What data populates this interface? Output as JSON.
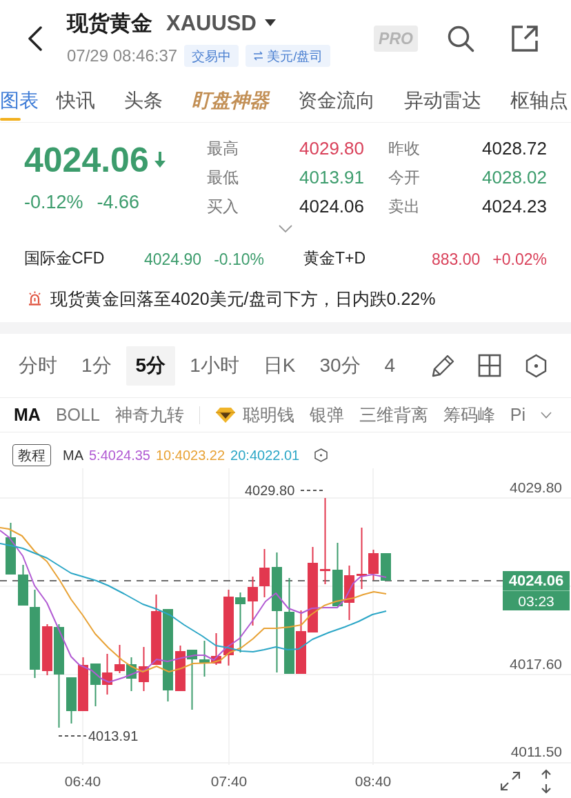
{
  "header": {
    "title": "现货黄金",
    "symbol": "XAUUSD",
    "time": "07/29 08:46:37",
    "badges": [
      {
        "kind": "status",
        "text": "交易中"
      },
      {
        "kind": "toggle",
        "text": "美元/盘司"
      }
    ],
    "pro": "PRO"
  },
  "tabs": [
    {
      "label": "图表",
      "selected": true,
      "kind": "plain"
    },
    {
      "label": "快讯",
      "selected": false,
      "kind": "plain"
    },
    {
      "label": "头条",
      "selected": false,
      "kind": "plain"
    },
    {
      "label": "盯盘神器",
      "selected": false,
      "kind": "featured"
    },
    {
      "label": "资金流向",
      "selected": false,
      "kind": "plain"
    },
    {
      "label": "异动雷达",
      "selected": false,
      "kind": "plain"
    },
    {
      "label": "枢轴点",
      "selected": false,
      "kind": "plain"
    }
  ],
  "quote": {
    "price": "4024.06",
    "falling": true,
    "change_percent": "-0.12%",
    "change": "-4.66",
    "stats": [
      {
        "label": "最高",
        "value": "4029.80",
        "color": "#d9415a"
      },
      {
        "label": "昨收",
        "value": "4028.72",
        "color": "#222222"
      },
      {
        "label": "最低",
        "value": "4013.91",
        "color": "#3c9c6c"
      },
      {
        "label": "今开",
        "value": "4028.02",
        "color": "#3c9c6c"
      },
      {
        "label": "买入",
        "value": "4024.06",
        "color": "#222222"
      },
      {
        "label": "卖出",
        "value": "4024.23",
        "color": "#222222"
      }
    ]
  },
  "related": [
    {
      "name": "国际金CFD",
      "price": "4024.90",
      "change": "-0.10%",
      "color": "#3c9c6c"
    },
    {
      "name": "黄金T+D",
      "price": "883.00",
      "change": "+0.02%",
      "color": "#d9415a"
    }
  ],
  "alert": {
    "text": "现货黄金回落至4020美元/盘司下方，日内跌0.22%"
  },
  "periods": [
    {
      "label": "分时",
      "selected": false
    },
    {
      "label": "1分",
      "selected": false
    },
    {
      "label": "5分",
      "selected": true
    },
    {
      "label": "1小时",
      "selected": false
    },
    {
      "label": "日K",
      "selected": false
    },
    {
      "label": "30分",
      "selected": false
    },
    {
      "label": "4",
      "selected": false
    }
  ],
  "indicators": {
    "main": [
      {
        "label": "MA",
        "selected": true
      },
      {
        "label": "BOLL",
        "selected": false
      },
      {
        "label": "神奇九转",
        "selected": false
      }
    ],
    "extra": [
      {
        "label": "聪明钱",
        "kind": "gem",
        "selected": false
      },
      {
        "label": "银弹",
        "kind": "plain",
        "selected": false
      },
      {
        "label": "三维背离",
        "kind": "plain",
        "selected": false
      },
      {
        "label": "筹码峰",
        "kind": "plain",
        "selected": false
      },
      {
        "label": "Pi",
        "kind": "plain",
        "selected": false
      }
    ]
  },
  "chart": {
    "tutorial": "教程",
    "legend_label": "MA",
    "legend": [
      {
        "text": "5:4024.35",
        "color": "#b15ad3"
      },
      {
        "text": "10:4023.22",
        "color": "#e8a235"
      },
      {
        "text": "20:4022.01",
        "color": "#2ba6c6"
      }
    ],
    "price_axis": [
      "4029.80",
      "4017.60",
      "4011.50"
    ],
    "high_label": "4029.80",
    "low_label": "4013.91",
    "last_price": "4024.06",
    "countdown": "03:23",
    "time_axis": [
      "06:40",
      "07:40",
      "08:40"
    ]
  }
}
